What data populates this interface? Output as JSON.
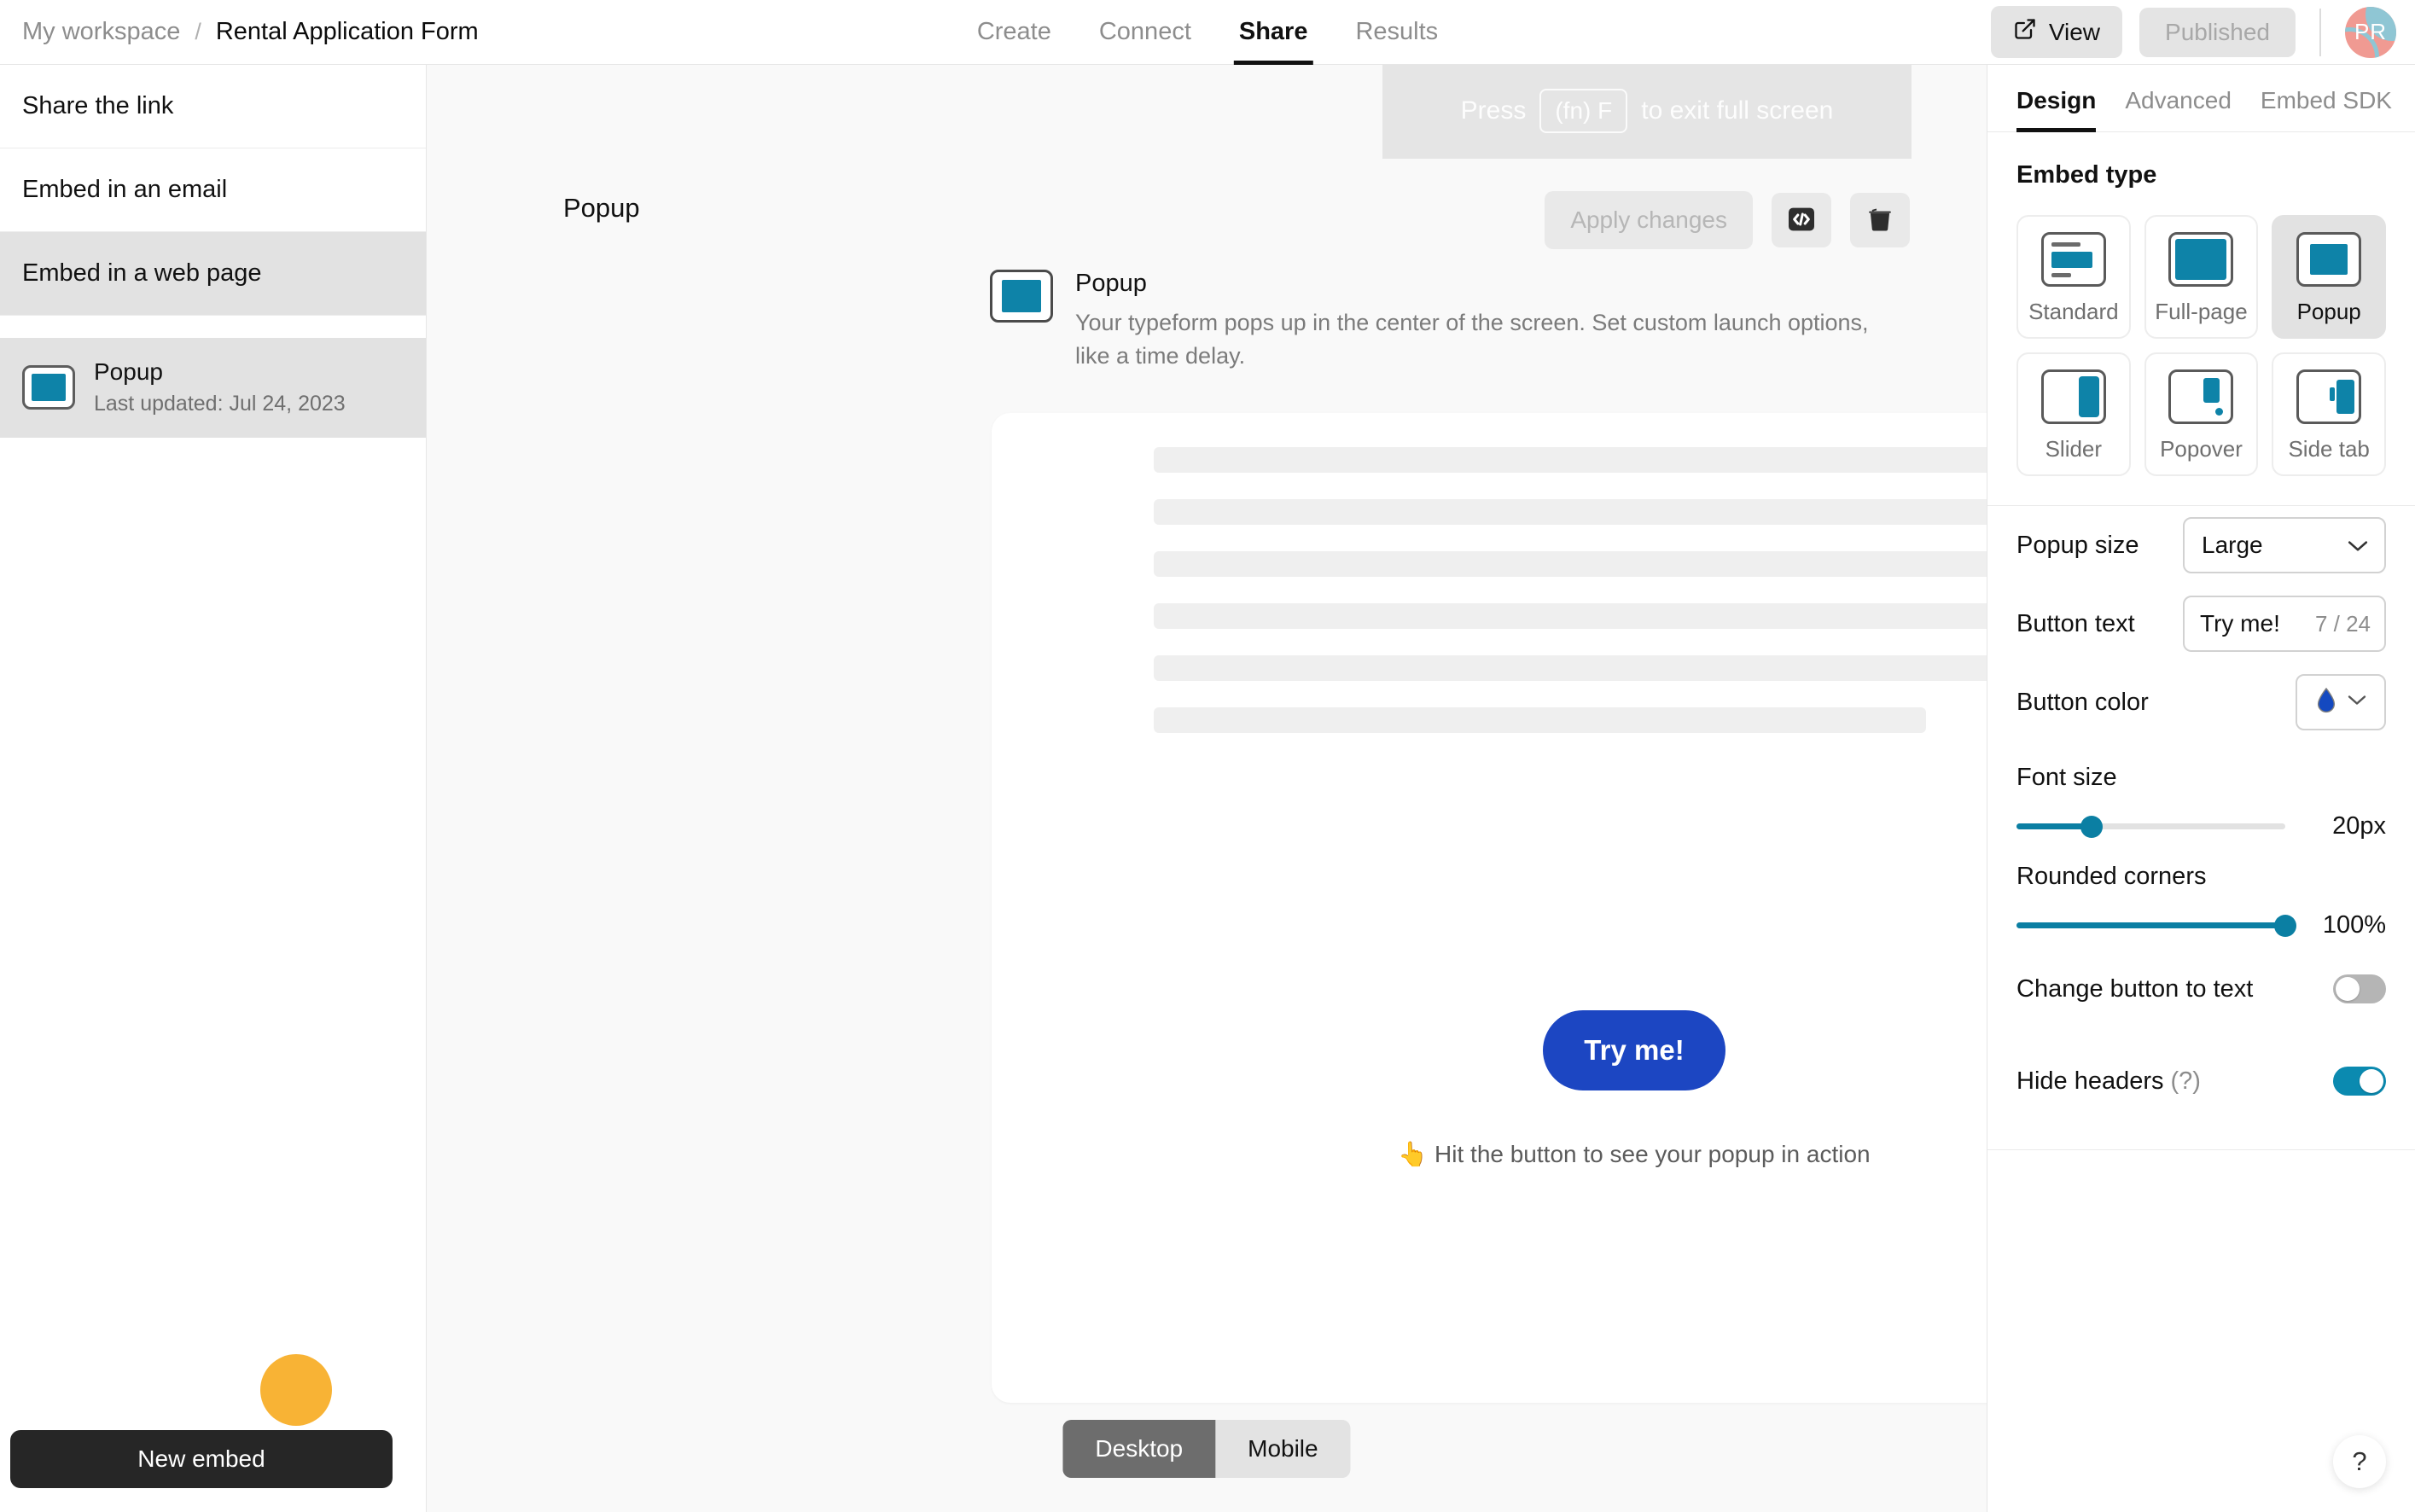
{
  "breadcrumb": {
    "workspace": "My workspace",
    "separator": "/",
    "form": "Rental Application Form"
  },
  "nav": {
    "tabs": [
      {
        "label": "Create",
        "active": false
      },
      {
        "label": "Connect",
        "active": false
      },
      {
        "label": "Share",
        "active": true
      },
      {
        "label": "Results",
        "active": false
      }
    ]
  },
  "top_right": {
    "view_label": "View",
    "published_label": "Published",
    "avatar_initials": "PR"
  },
  "sidebar": {
    "items": [
      {
        "label": "Share the link",
        "selected": false
      },
      {
        "label": "Embed in an email",
        "selected": false
      },
      {
        "label": "Embed in a web page",
        "selected": true
      }
    ],
    "embed_list": [
      {
        "title": "Popup",
        "subtitle": "Last updated: Jul 24, 2023",
        "selected": true
      }
    ],
    "new_embed_tooltip": "New embed"
  },
  "center": {
    "title": "Popup",
    "apply_label": "Apply changes",
    "fullscreen_hint": {
      "prefix": "Press",
      "key": "(fn) F",
      "suffix": "to exit full screen"
    },
    "type_description": {
      "name": "Popup",
      "text": "Your typeform pops up in the center of the screen. Set custom launch options, like a time delay."
    },
    "skeleton_bars": [
      1,
      1,
      1,
      1,
      1,
      0
    ],
    "try_button_label": "Try me!",
    "try_hint": "👆 Hit the button to see your popup in action",
    "try_button_color": "#1c46c2",
    "device_toggle": [
      {
        "label": "Desktop",
        "active": true
      },
      {
        "label": "Mobile",
        "active": false
      }
    ]
  },
  "right_panel": {
    "tabs": [
      {
        "label": "Design",
        "active": true
      },
      {
        "label": "Advanced",
        "active": false
      },
      {
        "label": "Embed SDK",
        "active": false
      }
    ],
    "embed_type_heading": "Embed type",
    "embed_types": [
      {
        "label": "Standard",
        "selected": false,
        "icon": "standard-embed-icon"
      },
      {
        "label": "Full-page",
        "selected": false,
        "icon": "fullpage-embed-icon"
      },
      {
        "label": "Popup",
        "selected": true,
        "icon": "popup-embed-icon"
      },
      {
        "label": "Slider",
        "selected": false,
        "icon": "slider-embed-icon"
      },
      {
        "label": "Popover",
        "selected": false,
        "icon": "popover-embed-icon"
      },
      {
        "label": "Side tab",
        "selected": false,
        "icon": "sidetab-embed-icon"
      }
    ],
    "popup_size": {
      "label": "Popup size",
      "value": "Large"
    },
    "button_text": {
      "label": "Button text",
      "value": "Try me!",
      "counter": "7 / 24"
    },
    "button_color": {
      "label": "Button color",
      "swatch": "#1449c0"
    },
    "font_size": {
      "label": "Font size",
      "value": "20px",
      "percent": 28
    },
    "rounded_corners": {
      "label": "Rounded corners",
      "value": "100%",
      "percent": 100
    },
    "change_button_to_text": {
      "label": "Change button to text",
      "on": false
    },
    "hide_headers": {
      "label": "Hide headers",
      "hint": "(?)",
      "on": true
    },
    "help_glyph": "?"
  },
  "colors": {
    "accent_teal": "#0e83a8",
    "accent_blue": "#1c46c2",
    "fab_yellow": "#f8b335"
  }
}
